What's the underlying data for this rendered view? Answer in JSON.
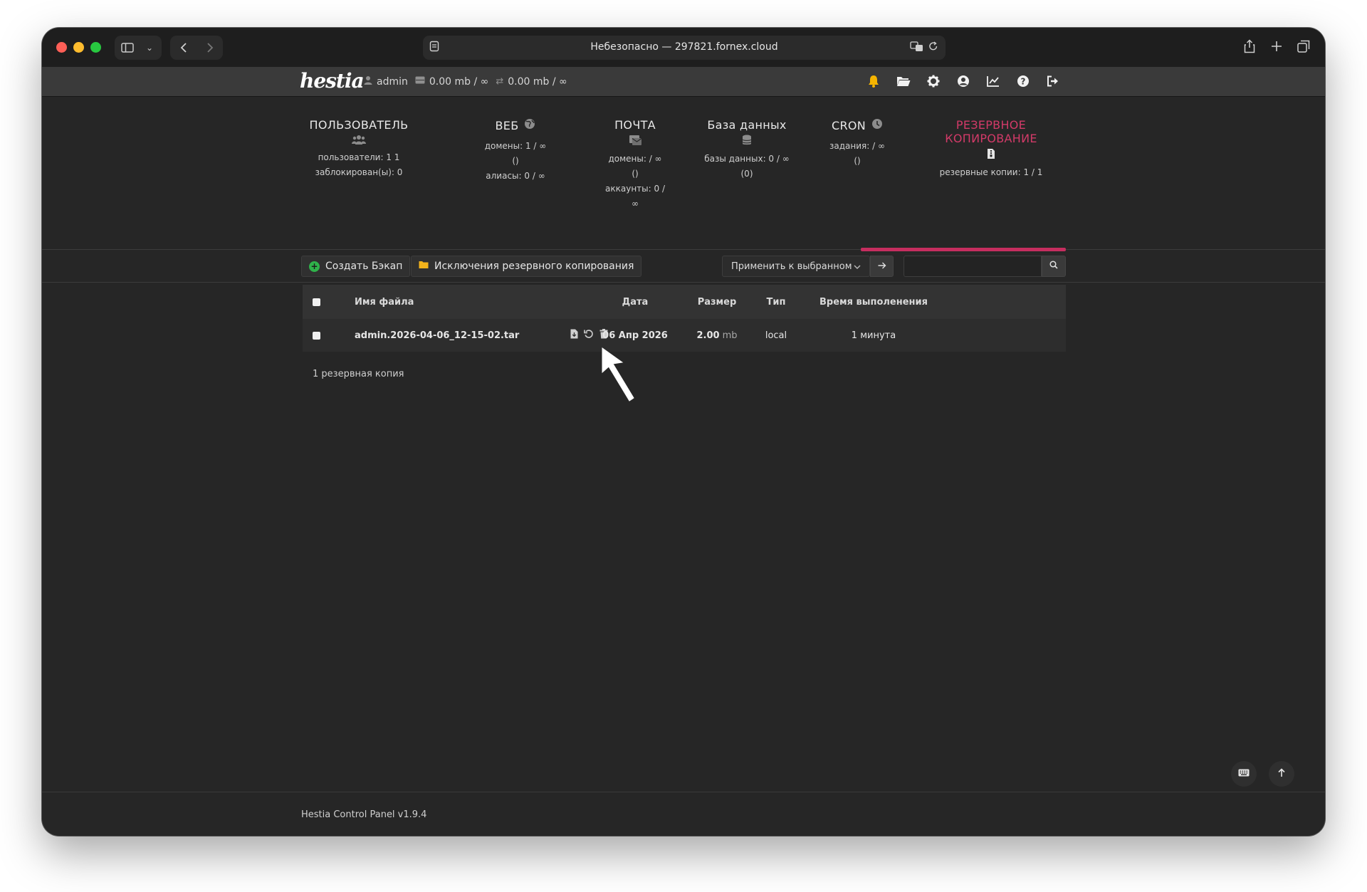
{
  "browser": {
    "url_text": "Небезопасно — 297821.fornex.cloud",
    "icons": [
      "sidebar-icon",
      "chevron-down-icon",
      "back-icon",
      "forward-icon",
      "page-icon",
      "translate-icon",
      "reload-icon",
      "share-icon",
      "plus-icon",
      "tabs-icon"
    ]
  },
  "header": {
    "logo": "hestia",
    "user": "admin",
    "disk": "0.00 mb / ∞",
    "bandwidth": "0.00 mb / ∞",
    "icons": [
      "bell-icon",
      "folder-icon",
      "gear-icon",
      "user-circle-icon",
      "chart-icon",
      "help-icon",
      "logout-icon"
    ],
    "colors": {
      "bell": "#f5b400"
    }
  },
  "stats": {
    "user": {
      "label": "ПОЛЬЗОВАТЕЛЬ",
      "line1": "пользователи: 1 1",
      "line2": "заблокирован(ы): 0"
    },
    "web": {
      "label": "ВЕБ",
      "line1": "домены: 1 / ∞",
      "line2": "()",
      "line3": "алиасы: 0 / ∞"
    },
    "mail": {
      "label": "ПОЧТА",
      "line1": "домены: / ∞",
      "line2": "()",
      "line3": "аккаунты: 0 /",
      "line4": "∞"
    },
    "db": {
      "label": "База данных",
      "line1": "базы данных: 0 / ∞",
      "line2": "(0)"
    },
    "cron": {
      "label": "CRON",
      "line1": "задания: / ∞",
      "line2": "()"
    },
    "backup": {
      "label": "РЕЗЕРВНОЕ КОПИРОВАНИЕ",
      "line1": "резервные копии: 1 / 1"
    },
    "active_color": "#d23a68"
  },
  "toolbar": {
    "create_backup": "Создать Бэкап",
    "exclusions": "Исключения резервного копирования",
    "bulk_action": "Применить к выбранном",
    "search_placeholder": ""
  },
  "table": {
    "headers": {
      "filename": "Имя файла",
      "date": "Дата",
      "size": "Размер",
      "type": "Тип",
      "runtime": "Время выполенения"
    },
    "rows": [
      {
        "filename": "admin.2026-04-06_12-15-02.tar",
        "date": "06 Апр 2026",
        "size": "2.00",
        "size_unit": "mb",
        "type": "local",
        "runtime": "1 минута"
      }
    ]
  },
  "count_text": "1 резервная копия",
  "footer": {
    "version": "Hestia Control Panel v1.9.4"
  }
}
